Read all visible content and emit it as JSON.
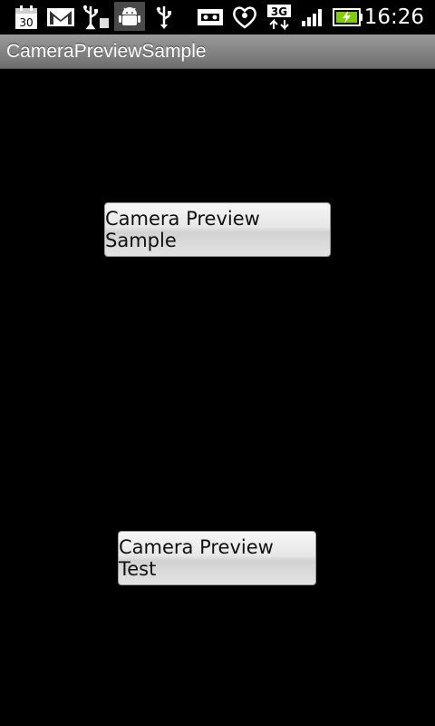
{
  "status_bar": {
    "time": "16:26",
    "calendar_day": "30",
    "network_type": "3G",
    "icons": [
      "calendar-icon",
      "gmail-icon",
      "usb-debug-icon",
      "android-debug-icon",
      "usb-icon",
      "voicemail-icon",
      "heart-icon",
      "3g-data-icon",
      "signal-icon",
      "battery-charging-icon"
    ]
  },
  "title_bar": {
    "title": "CameraPreviewSample"
  },
  "buttons": {
    "camera_preview_sample": "Camera Preview Sample",
    "camera_preview_test": "Camera Preview Test"
  },
  "colors": {
    "background": "#000000",
    "title_bar": "#8a8a8a",
    "button_face": "#e5e5e5",
    "battery_charge": "#7fd000"
  }
}
